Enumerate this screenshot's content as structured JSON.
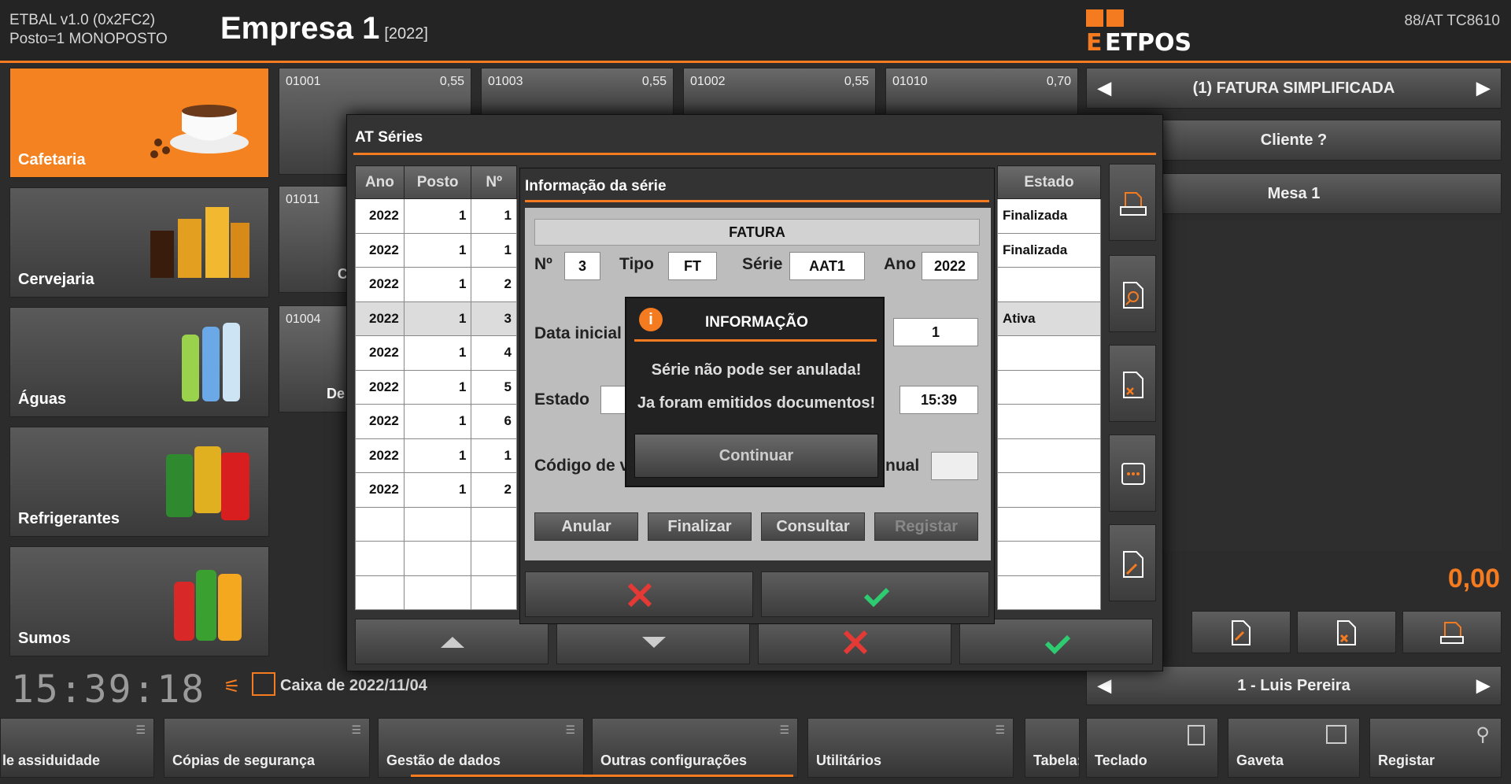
{
  "app": {
    "name": "ETBAL v1.0 (0x2FC2)",
    "station": "Posto=1 MONOPOSTO",
    "company": "Empresa 1",
    "year": "[2022]",
    "at_code": "88/AT TC8610",
    "logo": "ETPOS"
  },
  "categories": [
    {
      "label": "Cafetaria",
      "icon": "coffee-cup-icon",
      "active": true
    },
    {
      "label": "Cervejaria",
      "icon": "beer-glasses-icon"
    },
    {
      "label": "Águas",
      "icon": "water-bottles-icon"
    },
    {
      "label": "Refrigerantes",
      "icon": "soda-cans-icon"
    },
    {
      "label": "Sumos",
      "icon": "juice-bottles-icon"
    }
  ],
  "products": [
    {
      "code": "01001",
      "price": "0,55"
    },
    {
      "code": "01003",
      "price": "0,55"
    },
    {
      "code": "01002",
      "price": "0,55"
    },
    {
      "code": "01010",
      "price": "0,70"
    },
    {
      "code": "01011",
      "label": "C"
    },
    {
      "code": "01004",
      "label": "De"
    }
  ],
  "right_panel": {
    "doc_type": "(1) FATURA SIMPLIFICADA",
    "client": "Cliente ?",
    "table": "Mesa 1",
    "total": "0,00",
    "operator": "1 - Luis Pereira"
  },
  "bottom": {
    "clock": "15:39:18",
    "cash": "Caixa de 2022/11/04",
    "menus": [
      "le assiduidade",
      "Cópias de segurança",
      "Gestão de dados",
      "Outras configurações",
      "Utilitários",
      "Tabela:"
    ],
    "actions": [
      "Teclado",
      "Gaveta",
      "Registar"
    ]
  },
  "at_series": {
    "title": "AT Séries",
    "columns": [
      "Ano",
      "Posto",
      "Nº",
      "Estado"
    ],
    "rows": [
      {
        "ano": "2022",
        "posto": "1",
        "n": "1",
        "estado": "Finalizada"
      },
      {
        "ano": "2022",
        "posto": "1",
        "n": "1",
        "estado": "Finalizada"
      },
      {
        "ano": "2022",
        "posto": "1",
        "n": "2",
        "estado": ""
      },
      {
        "ano": "2022",
        "posto": "1",
        "n": "3",
        "estado": "Ativa"
      },
      {
        "ano": "2022",
        "posto": "1",
        "n": "4",
        "estado": ""
      },
      {
        "ano": "2022",
        "posto": "1",
        "n": "5",
        "estado": ""
      },
      {
        "ano": "2022",
        "posto": "1",
        "n": "6",
        "estado": ""
      },
      {
        "ano": "2022",
        "posto": "1",
        "n": "1",
        "estado": ""
      },
      {
        "ano": "2022",
        "posto": "1",
        "n": "2",
        "estado": ""
      }
    ]
  },
  "series_info": {
    "title": "Informação da série",
    "doc": "FATURA",
    "n_label": "Nº",
    "n": "3",
    "tipo_label": "Tipo",
    "tipo": "FT",
    "serie_label": "Série",
    "serie": "AAT1",
    "ano_label": "Ano",
    "ano": "2022",
    "data_inicial_label": "Data inicial",
    "data_value": "1",
    "estado_label": "Estado",
    "time": "15:39",
    "codigo_label": "Código de va",
    "manual_label": "nual",
    "buttons": [
      "Anular",
      "Finalizar",
      "Consultar",
      "Registar"
    ]
  },
  "dialog": {
    "title": "INFORMAÇÃO",
    "line1": "Série não pode ser anulada!",
    "line2": "Ja foram emitidos documentos!",
    "button": "Continuar"
  },
  "colors": {
    "accent": "#f47b20",
    "confirm": "#2ecc71",
    "cancel": "#e53935"
  }
}
